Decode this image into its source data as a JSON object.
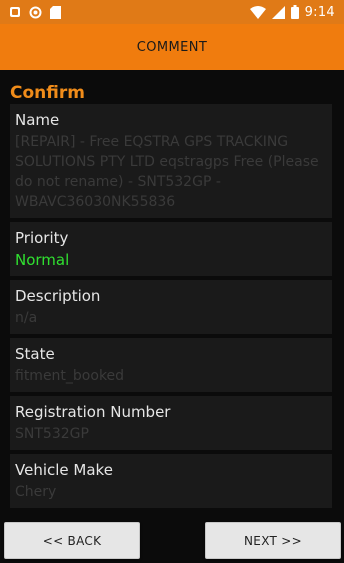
{
  "status_bar": {
    "time": "9:14",
    "icons_left": [
      "notification-icon",
      "sync-icon",
      "sd-card-icon"
    ],
    "icons_right": [
      "wifi-icon",
      "signal-icon",
      "battery-icon"
    ]
  },
  "app_bar": {
    "title": "COMMENT"
  },
  "section_title": "Confirm",
  "fields": [
    {
      "label": "Name",
      "value": "[REPAIR] - Free EQSTRA GPS TRACKING SOLUTIONS PTY LTD eqstragps Free (Please do not rename) - SNT532GP - WBAVC36030NK55836"
    },
    {
      "label": "Priority",
      "value": "Normal"
    },
    {
      "label": "Description",
      "value": "n/a"
    },
    {
      "label": "State",
      "value": "fitment_booked"
    },
    {
      "label": "Registration Number",
      "value": "SNT532GP"
    },
    {
      "label": "Vehicle Make",
      "value": "Chery"
    }
  ],
  "buttons": {
    "back": "<< BACK",
    "next": "NEXT >>"
  },
  "colors": {
    "accent": "#f07c0e",
    "priority_value": "#30e030",
    "section_title": "#f08c1a"
  }
}
